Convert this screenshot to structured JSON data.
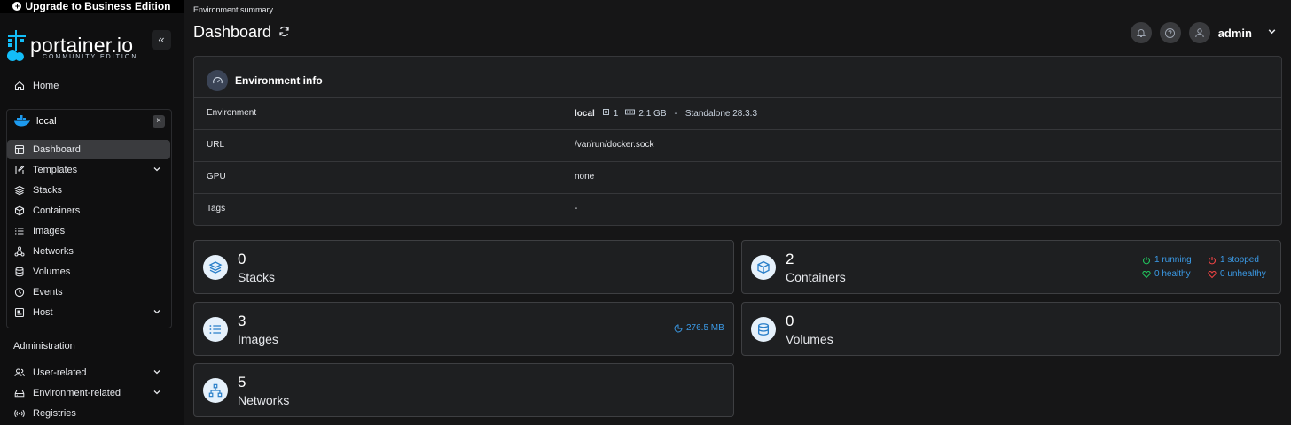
{
  "banner": {
    "label": "Upgrade to Business Edition"
  },
  "brand": {
    "name": "portainer.io",
    "edition": "COMMUNITY EDITION"
  },
  "sidebar": {
    "home": "Home",
    "environment": {
      "name": "local",
      "items": [
        {
          "label": "Dashboard",
          "icon": "layout-icon",
          "active": true
        },
        {
          "label": "Templates",
          "icon": "edit-icon",
          "expandable": true
        },
        {
          "label": "Stacks",
          "icon": "layers-icon"
        },
        {
          "label": "Containers",
          "icon": "box-icon"
        },
        {
          "label": "Images",
          "icon": "list-icon"
        },
        {
          "label": "Networks",
          "icon": "network-icon"
        },
        {
          "label": "Volumes",
          "icon": "database-icon"
        },
        {
          "label": "Events",
          "icon": "clock-icon"
        },
        {
          "label": "Host",
          "icon": "host-icon",
          "expandable": true
        }
      ]
    },
    "administration": {
      "title": "Administration",
      "items": [
        {
          "label": "User-related",
          "icon": "users-icon",
          "expandable": true
        },
        {
          "label": "Environment-related",
          "icon": "hdd-icon",
          "expandable": true
        },
        {
          "label": "Registries",
          "icon": "radio-icon"
        }
      ]
    }
  },
  "header": {
    "breadcrumb": "Environment summary",
    "title": "Dashboard",
    "user": "admin"
  },
  "env_info": {
    "title": "Environment info",
    "rows": [
      {
        "key": "Environment",
        "value": "local",
        "cpu": "1",
        "memory": "2.1 GB",
        "separator": "-",
        "type": "Standalone 28.3.3"
      },
      {
        "key": "URL",
        "value": "/var/run/docker.sock"
      },
      {
        "key": "GPU",
        "value": "none"
      },
      {
        "key": "Tags",
        "value": "-"
      }
    ]
  },
  "cards": {
    "stacks": {
      "count": "0",
      "label": "Stacks"
    },
    "containers": {
      "count": "2",
      "label": "Containers",
      "running": "1 running",
      "stopped": "1 stopped",
      "healthy": "0 healthy",
      "unhealthy": "0 unhealthy"
    },
    "images": {
      "count": "3",
      "label": "Images",
      "size": "276.5 MB"
    },
    "volumes": {
      "count": "0",
      "label": "Volumes"
    },
    "networks": {
      "count": "5",
      "label": "Networks"
    }
  },
  "colors": {
    "accent": "#3b9ae6",
    "good": "#22c55e",
    "bad": "#ef4444",
    "active_nav": "#3a3b3e"
  }
}
